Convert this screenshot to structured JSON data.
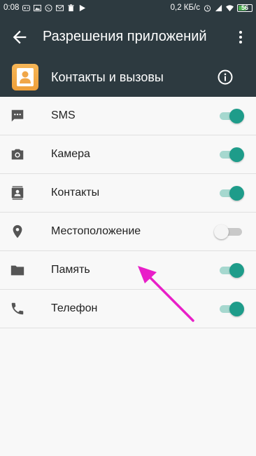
{
  "status_bar": {
    "time": "0:08",
    "speed": "0,2 КБ/с",
    "battery": "56",
    "colors": {
      "background": "#2d3a40",
      "battery_fill": "#4caf50"
    }
  },
  "toolbar": {
    "title": "Разрешения приложений",
    "back_icon": "arrow-left-icon",
    "menu_icon": "more-vert-icon"
  },
  "app": {
    "name": "Контакты и вызовы",
    "icon": "contacts-app-icon",
    "info_icon": "info-icon"
  },
  "permissions": [
    {
      "label": "SMS",
      "icon": "sms-icon",
      "enabled": true
    },
    {
      "label": "Камера",
      "icon": "camera-icon",
      "enabled": true
    },
    {
      "label": "Контакты",
      "icon": "contacts-icon",
      "enabled": true
    },
    {
      "label": "Местоположение",
      "icon": "location-icon",
      "enabled": false
    },
    {
      "label": "Память",
      "icon": "folder-icon",
      "enabled": true
    },
    {
      "label": "Телефон",
      "icon": "phone-icon",
      "enabled": true
    }
  ],
  "colors": {
    "header": "#2d3a40",
    "accent": "#1e9c8a",
    "annotation_arrow": "#e81fc8",
    "background": "#f8f8f8"
  }
}
